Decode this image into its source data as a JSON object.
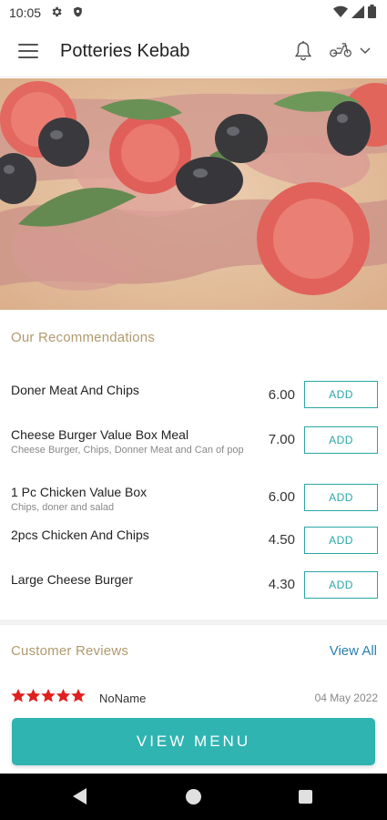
{
  "status_bar": {
    "time": "10:05",
    "icons": [
      "gear-icon",
      "shield-icon",
      "wifi-icon",
      "signal-icon",
      "battery-icon"
    ]
  },
  "app_bar": {
    "title": "Potteries Kebab",
    "icons": [
      "hamburger-menu-icon",
      "bell-icon",
      "scooter-icon",
      "chevron-down-icon"
    ]
  },
  "hero": {
    "image": "pizza-image"
  },
  "recommendations": {
    "title": "Our Recommendations",
    "add_label": "ADD",
    "items": [
      {
        "name": "Doner Meat And Chips",
        "desc": "",
        "price": "6.00"
      },
      {
        "name": "Cheese Burger Value Box Meal",
        "desc": "Cheese Burger, Chips, Donner Meat and Can of pop",
        "price": "7.00"
      },
      {
        "name": "1 Pc Chicken Value Box",
        "desc": "Chips, doner and salad",
        "price": "6.00"
      },
      {
        "name": "2pcs Chicken And Chips",
        "desc": "",
        "price": "4.50"
      },
      {
        "name": "Large Cheese Burger",
        "desc": "",
        "price": "4.30"
      }
    ]
  },
  "reviews": {
    "title": "Customer Reviews",
    "view_all": "View All",
    "items": [
      {
        "rating": 5,
        "reviewer": "NoName",
        "date": "04 May 2022"
      }
    ]
  },
  "cta": {
    "label": "VIEW MENU"
  },
  "nav_bar": {
    "icons": [
      "back-icon",
      "home-icon",
      "recents-icon"
    ]
  },
  "colors": {
    "accent": "#2fb4b2",
    "section_title": "#b19a6d",
    "link": "#2a7fb0",
    "star": "#e02020"
  }
}
